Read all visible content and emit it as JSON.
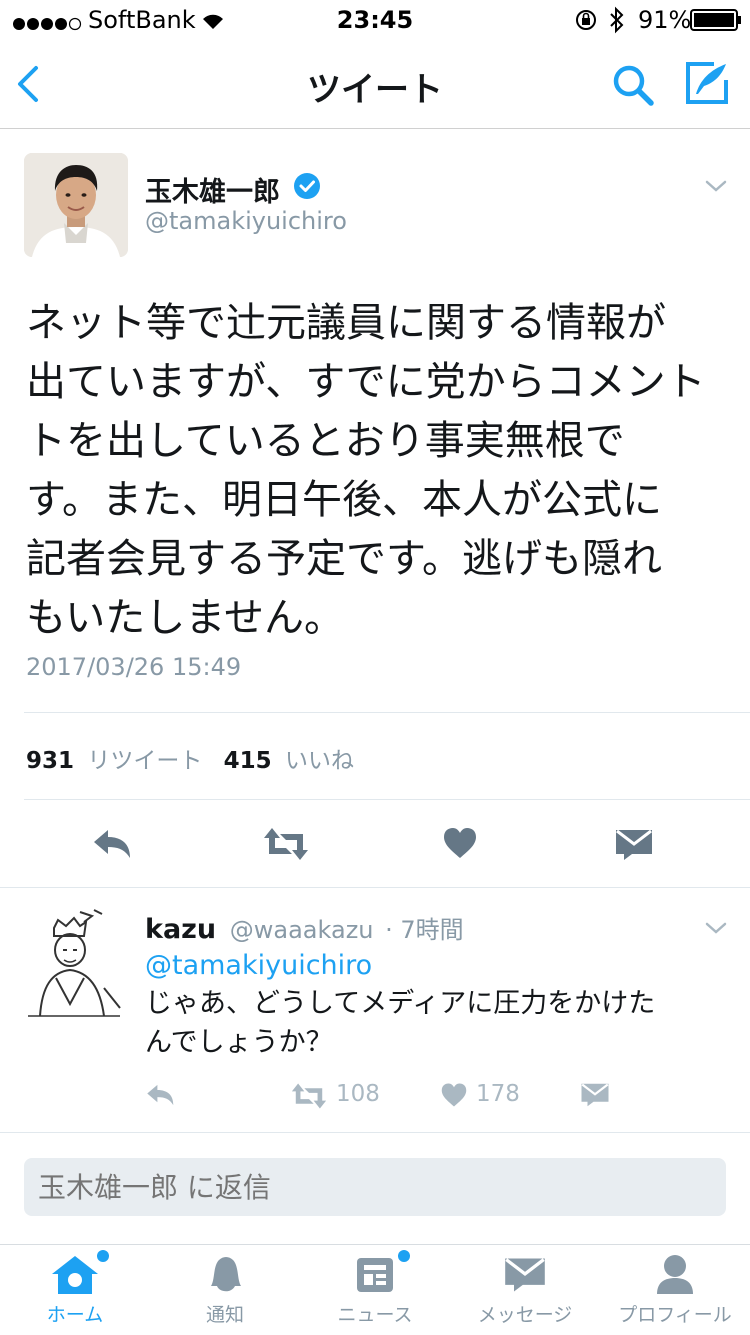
{
  "status_bar": {
    "carrier": "SoftBank",
    "time": "23:45",
    "battery": "91%"
  },
  "nav": {
    "title": "ツイート",
    "icons": [
      "back-icon",
      "search-icon",
      "compose-icon"
    ]
  },
  "tweet": {
    "author_name": "玉木雄一郎",
    "handle": "@tamakiyuichiro",
    "verified": true,
    "text_lines": [
      "ネット等で辻元議員に関する情報が",
      "出ていますが、すでに党からコメント",
      "トを出しているとおり事実無根で",
      "す。また、明日午後、本人が公式に",
      "記者会見する予定です。逃げも隠れ",
      "もいたしません。"
    ],
    "timestamp": "2017/03/26 15:49",
    "retweet_count": "931",
    "retweet_label": "リツイート",
    "like_count": "415",
    "like_label": "いいね"
  },
  "reply": {
    "name": "kazu",
    "handle": "@waaakazu",
    "time": "· 7時間",
    "mention": "@tamakiyuichiro",
    "text_lines": [
      "じゃあ、どうしてメディアに圧力をかけた",
      "んでしょうか？"
    ],
    "retweet_count": "108",
    "like_count": "178"
  },
  "reply_box": {
    "placeholder": "玉木雄一郎 に返信"
  },
  "tabbar": {
    "items": [
      {
        "label": "ホーム",
        "icon": "home-icon",
        "active": true
      },
      {
        "label": "通知",
        "icon": "bell-icon"
      },
      {
        "label": "ニュース",
        "icon": "news-icon"
      },
      {
        "label": "メッセージ",
        "icon": "mail-icon"
      },
      {
        "label": "プロフィール",
        "icon": "profile-icon"
      }
    ]
  },
  "colors": {
    "accent": "#1da1f2",
    "muted": "#8899a6",
    "divider": "#e1e8ed"
  }
}
